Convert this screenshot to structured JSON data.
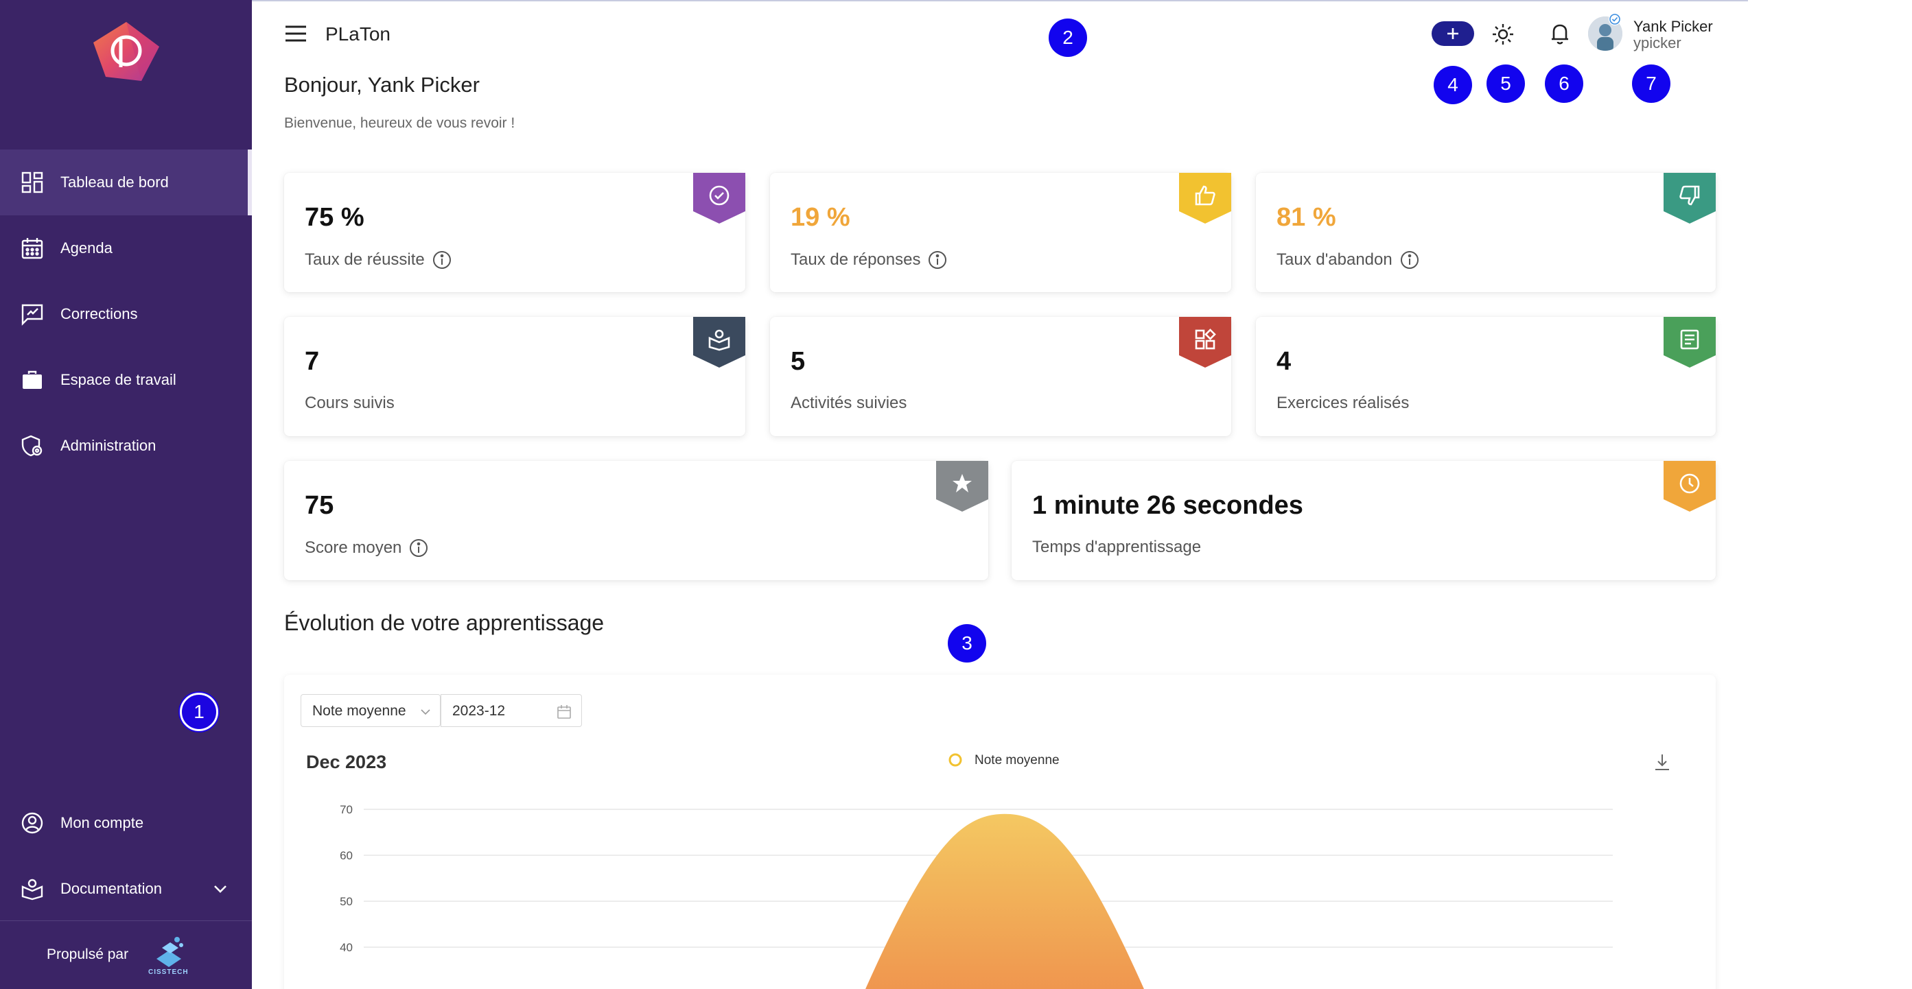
{
  "app": {
    "title": "PLaTon"
  },
  "sidebar": {
    "items": [
      {
        "label": "Tableau de bord",
        "icon": "dashboard-icon",
        "active": true
      },
      {
        "label": "Agenda",
        "icon": "calendar-icon"
      },
      {
        "label": "Corrections",
        "icon": "corrections-icon"
      },
      {
        "label": "Espace de travail",
        "icon": "briefcase-icon"
      },
      {
        "label": "Administration",
        "icon": "admin-icon"
      }
    ],
    "bottom_items": [
      {
        "label": "Mon compte",
        "icon": "account-icon"
      },
      {
        "label": "Documentation",
        "icon": "documentation-icon"
      }
    ],
    "powered_by": "Propulsé par",
    "powered_brand": "CISSTECH"
  },
  "header": {
    "user_name": "Yank Picker",
    "user_login": "ypicker"
  },
  "greeting": {
    "title": "Bonjour, Yank Picker",
    "subtitle": "Bienvenue, heureux de vous revoir !"
  },
  "stats": [
    {
      "value": "75 %",
      "label": "Taux de réussite",
      "info": true,
      "color": "#8c4fb0",
      "icon": "check-circle-icon",
      "value_color": "default"
    },
    {
      "value": "19 %",
      "label": "Taux de réponses",
      "info": true,
      "color": "#f2c230",
      "icon": "thumbs-up-icon",
      "value_color": "orange"
    },
    {
      "value": "81 %",
      "label": "Taux d'abandon",
      "info": true,
      "color": "#3a9a83",
      "icon": "thumbs-down-icon",
      "value_color": "orange"
    },
    {
      "value": "7",
      "label": "Cours suivis",
      "info": false,
      "color": "#3b4a5e",
      "icon": "course-icon"
    },
    {
      "value": "5",
      "label": "Activités suivies",
      "info": false,
      "color": "#c0453a",
      "icon": "activities-icon"
    },
    {
      "value": "4",
      "label": "Exercices réalisés",
      "info": false,
      "color": "#4aa05a",
      "icon": "exercise-icon"
    },
    {
      "value": "75",
      "label": "Score moyen",
      "info": true,
      "color": "#868a8d",
      "icon": "star-icon"
    },
    {
      "value": "1 minute 26 secondes",
      "label": "Temps d'apprentissage",
      "info": false,
      "color": "#f0a63a",
      "icon": "clock-icon"
    }
  ],
  "section": {
    "title": "Évolution de votre apprentissage"
  },
  "chart_controls": {
    "metric": "Note moyenne",
    "period": "2023-12"
  },
  "chart_data": {
    "type": "area",
    "title": "Dec 2023",
    "series": [
      {
        "name": "Note moyenne",
        "values": [
          0,
          69,
          0
        ]
      }
    ],
    "x": [
      "",
      "",
      ""
    ],
    "ylim": [
      30,
      70
    ],
    "yticks": [
      "70",
      "60",
      "50",
      "40"
    ],
    "grid": true,
    "legend": "top-center",
    "colors": {
      "top": "#f4c862",
      "bottom": "#ee8a4a",
      "legend_marker": "#f2c230"
    }
  },
  "markers": [
    "1",
    "2",
    "3",
    "4",
    "5",
    "6",
    "7"
  ]
}
